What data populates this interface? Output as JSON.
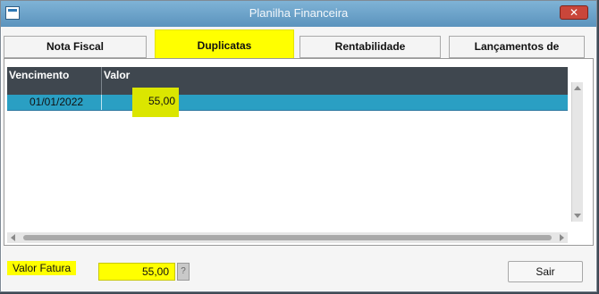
{
  "window": {
    "title": "Planilha Financeira",
    "close_icon": "close-icon"
  },
  "tabs": [
    {
      "label": "Nota Fiscal",
      "active": false
    },
    {
      "label": "Duplicatas",
      "active": true
    },
    {
      "label": "Rentabilidade",
      "active": false
    },
    {
      "label": "Lançamentos de Apuração",
      "active": false
    }
  ],
  "grid": {
    "columns": [
      "Vencimento",
      "Valor"
    ],
    "rows": [
      {
        "vencimento": "01/01/2022",
        "valor": "55,00"
      }
    ]
  },
  "footer": {
    "valor_fatura_label": "Valor Fatura",
    "valor_fatura_value": "55,00",
    "help_label": "?",
    "sair_label": "Sair"
  },
  "colors": {
    "titlebar": "#6aa3cd",
    "highlight": "#ffff00",
    "header_bg": "#3f474f",
    "row_selected": "#2a9fc3"
  }
}
